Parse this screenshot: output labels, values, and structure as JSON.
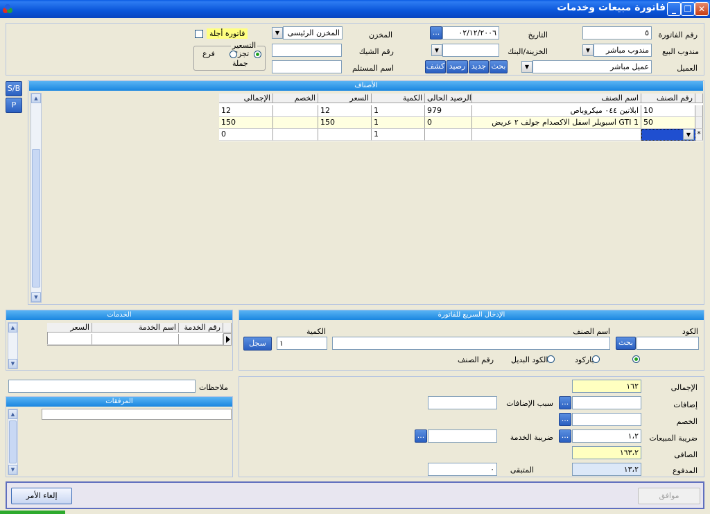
{
  "window": {
    "title": "فاتورة مبيعات وخدمات"
  },
  "header": {
    "invoice_no_label": "رقم الفاتورة",
    "invoice_no": "٥",
    "date_label": "التاريخ",
    "date": "٠٢/١٢/٢٠٠٦",
    "date_btn": "...",
    "store_label": "المخزن",
    "store": "المخزن الرئيسى",
    "credit_label": "فاتورة أجلة",
    "rep_label": "مندوب البيع",
    "rep": "مندوب مباشر",
    "treasury_label": "الخزينة/البنك",
    "treasury": "",
    "check_label": "رقم الشيك",
    "check": "",
    "pricing_label": "التسعير",
    "pricing_retail": "تجزئة",
    "pricing_branch": "فرع",
    "pricing_wholesale": "جملة",
    "customer_label": "العميل",
    "customer": "عميل مباشر",
    "receiver_label": "اسم المستلم",
    "receiver": "",
    "btn_search": "بحث",
    "btn_new": "جديد",
    "btn_balance": "رصيد",
    "btn_statement": "كشف"
  },
  "side_buttons": {
    "sb": "S/B",
    "p": "P"
  },
  "items": {
    "title": "الأصناف",
    "columns": [
      "رقم الصنف",
      "اسم الصنف",
      "الرصيد الحالى",
      "الكمية",
      "السعر",
      "الخصم",
      "الإجمالى"
    ],
    "rows": [
      {
        "code": "10",
        "name": "ابلاتين ٠٤٤   ميكروباص",
        "balance": "979",
        "qty": "1",
        "price": "12",
        "discount": "",
        "total": "12"
      },
      {
        "code": "50",
        "name": "GTI 1 اسبويلر اسفل الاكصدام جولف ٢ عريض",
        "balance": "0",
        "qty": "1",
        "price": "150",
        "discount": "",
        "total": "150"
      },
      {
        "code": "",
        "name": "",
        "balance": "",
        "qty": "1",
        "price": "",
        "discount": "",
        "total": "0"
      }
    ],
    "new_row_marker": "*"
  },
  "services": {
    "title": "الخدمات",
    "columns": [
      "رقم الخدمة",
      "اسم الخدمة",
      "السعر"
    ]
  },
  "quick_entry": {
    "title": "الإدخال السريع للفاتورة",
    "code_label": "الكود",
    "name_label": "اسم الصنف",
    "qty_label": "الكمية",
    "qty": "١",
    "search_btn": "بحث",
    "save_btn": "سجل",
    "opt_barcode": "الباركود",
    "opt_alt_code": "الكود البديل",
    "opt_item_no": "رقم الصنف"
  },
  "notes": {
    "label": "ملاحظات",
    "value": ""
  },
  "attachments": {
    "title": "المرفقات"
  },
  "totals": {
    "total_label": "الإجمالى",
    "total": "١٦٢",
    "additions_label": "إضافات",
    "additions": "",
    "additions_reason_label": "سبب الإضافات",
    "additions_reason": "",
    "discount_label": "الخصم",
    "discount": "",
    "sales_tax_label": "ضريبة المبيعات",
    "sales_tax": "١،٢",
    "service_tax_label": "ضريبة الخدمة",
    "service_tax": "",
    "net_label": "الصافى",
    "net": "١٦٣،٢",
    "paid_label": "المدفوع",
    "paid": "١٣،٢",
    "remaining_label": "المتبقى",
    "remaining": "٠",
    "ellipsis": "..."
  },
  "footer": {
    "ok": "موافق",
    "cancel": "إلغاء الأمر"
  }
}
